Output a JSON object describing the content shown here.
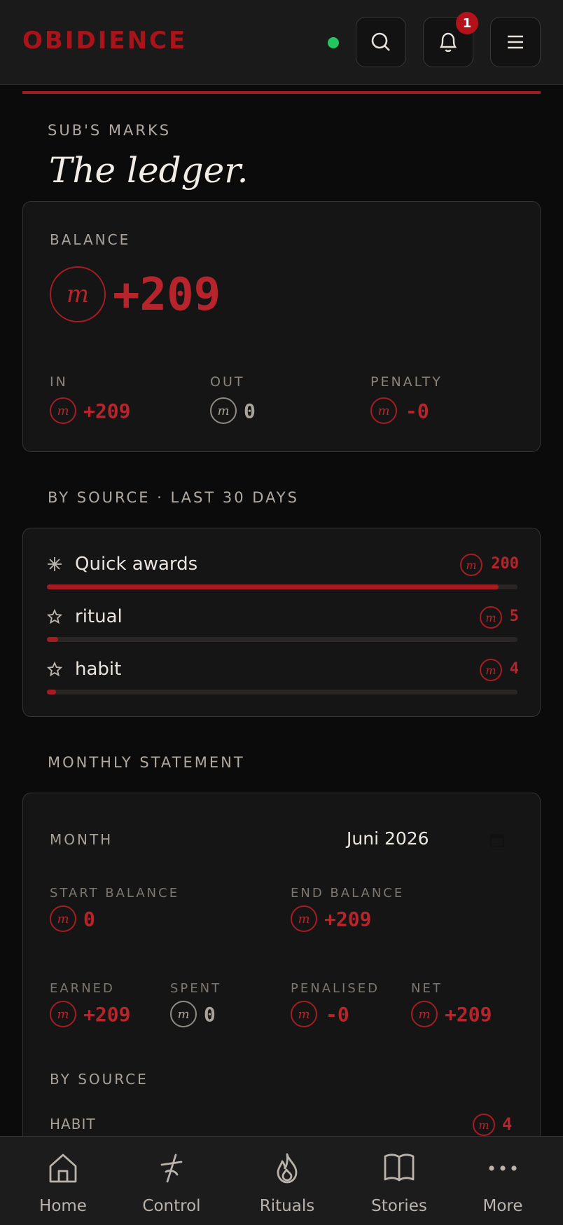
{
  "header": {
    "brand": "OBIDIENCE",
    "notification_count": "1"
  },
  "page": {
    "kicker": "SUB'S MARKS",
    "title": "The ledger."
  },
  "balance": {
    "label": "BALANCE",
    "coin_glyph": "m",
    "value": "+209",
    "in_label": "IN",
    "in_value": "+209",
    "out_label": "OUT",
    "out_value": "0",
    "penalty_label": "PENALTY",
    "penalty_value": "-0"
  },
  "by_source": {
    "heading": "BY SOURCE · LAST 30 DAYS",
    "items": [
      {
        "label": "Quick awards",
        "icon": "sparkle-icon",
        "amount": "200",
        "share": 0.96
      },
      {
        "label": "ritual",
        "icon": "star-icon",
        "amount": "5",
        "share": 0.024
      },
      {
        "label": "habit",
        "icon": "star-icon",
        "amount": "4",
        "share": 0.019
      }
    ]
  },
  "statement": {
    "heading": "MONTHLY STATEMENT",
    "month_label": "MONTH",
    "month_value": "Juni 2026",
    "start_balance_label": "START BALANCE",
    "start_balance_value": "0",
    "end_balance_label": "END BALANCE",
    "end_balance_value": "+209",
    "earned_label": "EARNED",
    "earned_value": "+209",
    "spent_label": "SPENT",
    "spent_value": "0",
    "penalised_label": "PENALISED",
    "penalised_value": "-0",
    "net_label": "NET",
    "net_value": "+209",
    "by_source_label": "BY SOURCE",
    "rows": [
      {
        "label": "HABIT",
        "amount": "4"
      }
    ]
  },
  "bottom_nav": [
    {
      "label": "Home",
      "icon": "home-icon"
    },
    {
      "label": "Control",
      "icon": "control-icon"
    },
    {
      "label": "Rituals",
      "icon": "flame-icon"
    },
    {
      "label": "Stories",
      "icon": "book-icon"
    },
    {
      "label": "More",
      "icon": "more-icon"
    }
  ],
  "colors": {
    "accent": "#a61c23",
    "online": "#22c55e",
    "background": "#0b0b0b"
  }
}
